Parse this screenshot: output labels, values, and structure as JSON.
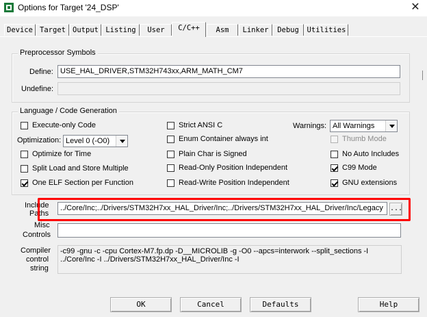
{
  "window": {
    "title": "Options for Target '24_DSP'"
  },
  "tabs": [
    {
      "label": "Device"
    },
    {
      "label": "Target"
    },
    {
      "label": "Output"
    },
    {
      "label": "Listing"
    },
    {
      "label": "User"
    },
    {
      "label": "C/C++"
    },
    {
      "label": "Asm"
    },
    {
      "label": "Linker"
    },
    {
      "label": "Debug"
    },
    {
      "label": "Utilities"
    }
  ],
  "active_tab": "C/C++",
  "preprocessor": {
    "title": "Preprocessor Symbols",
    "define_label": "Define:",
    "define_value": "USE_HAL_DRIVER,STM32H743xx,ARM_MATH_CM7",
    "undefine_label": "Undefine:",
    "undefine_value": ""
  },
  "language": {
    "title": "Language / Code Generation",
    "execute_only": {
      "label": "Execute-only Code",
      "checked": false
    },
    "optimization_label": "Optimization:",
    "optimization_value": "Level 0 (-O0)",
    "optimize_time": {
      "label": "Optimize for Time",
      "checked": false
    },
    "split_load": {
      "label": "Split Load and Store Multiple",
      "checked": false
    },
    "one_elf": {
      "label": "One ELF Section per Function",
      "checked": true
    },
    "strict_ansi": {
      "label": "Strict ANSI C",
      "checked": false
    },
    "enum_container": {
      "label": "Enum Container always int",
      "checked": false
    },
    "plain_char": {
      "label": "Plain Char is Signed",
      "checked": false
    },
    "ro_pos_indep": {
      "label": "Read-Only Position Independent",
      "checked": false
    },
    "rw_pos_indep": {
      "label": "Read-Write Position Independent",
      "checked": false
    },
    "warnings_label": "Warnings:",
    "warnings_value": "All Warnings",
    "thumb_mode": {
      "label": "Thumb Mode",
      "checked": false,
      "disabled": true
    },
    "no_auto_includes": {
      "label": "No Auto Includes",
      "checked": false
    },
    "c99_mode": {
      "label": "C99 Mode",
      "checked": true
    },
    "gnu_extensions": {
      "label": "GNU extensions",
      "checked": true
    }
  },
  "include": {
    "label_line1": "Include",
    "label_line2": "Paths",
    "value": "../Core/Inc;../Drivers/STM32H7xx_HAL_Driver/Inc;../Drivers/STM32H7xx_HAL_Driver/Inc/Legacy",
    "browse_label": "..."
  },
  "misc": {
    "label_line1": "Misc",
    "label_line2": "Controls",
    "value": ""
  },
  "compiler": {
    "label_line1": "Compiler",
    "label_line2": "control",
    "label_line3": "string",
    "line1": "-c99 -gnu -c -cpu Cortex-M7.fp.dp -D__MICROLIB -g -O0 --apcs=interwork --split_sections -I",
    "line2": "../Core/Inc -I ../Drivers/STM32H7xx_HAL_Driver/Inc -I"
  },
  "buttons": {
    "ok": "OK",
    "cancel": "Cancel",
    "defaults": "Defaults",
    "help": "Help"
  },
  "colors": {
    "highlight": "#ff0000",
    "dialog_bg": "#f0f0f0"
  }
}
